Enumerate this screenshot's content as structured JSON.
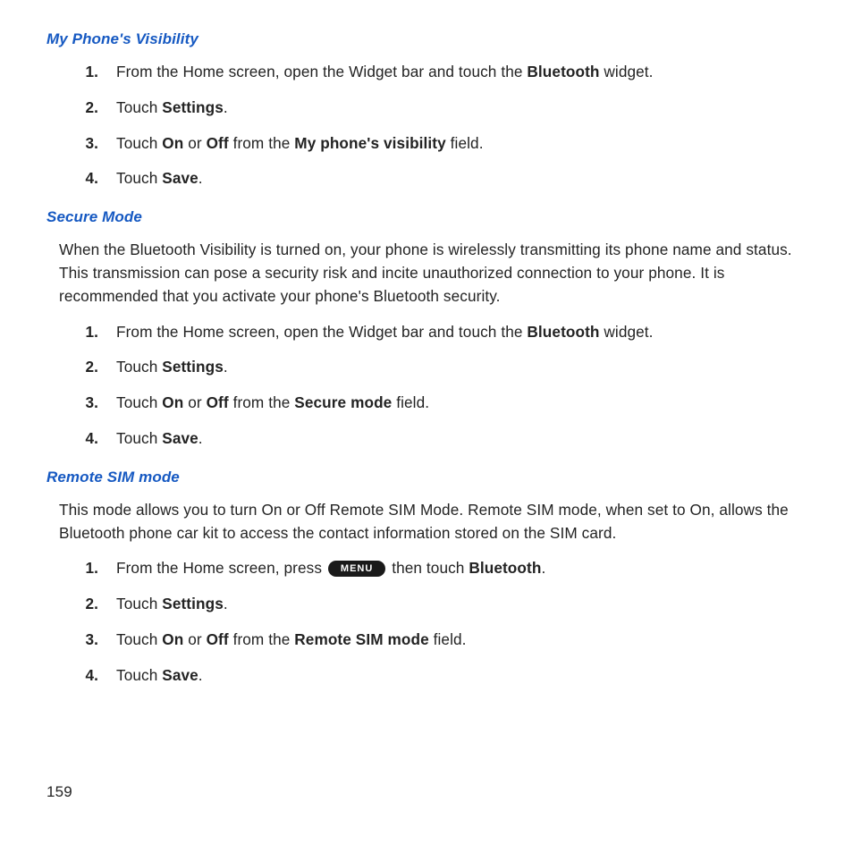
{
  "page_number": "159",
  "menu_icon_label": "MENU",
  "sections": [
    {
      "heading": "My Phone's Visibility",
      "paragraph": null,
      "steps": [
        {
          "num": "1.",
          "pre": "From the Home screen, open the Widget bar and touch the ",
          "bold1": "Bluetooth",
          "mid": " widget.",
          "bold2": null,
          "mid2": null,
          "bold3": null,
          "post": null,
          "has_menu": false
        },
        {
          "num": "2.",
          "pre": "Touch ",
          "bold1": "Settings",
          "mid": ".",
          "bold2": null,
          "mid2": null,
          "bold3": null,
          "post": null,
          "has_menu": false
        },
        {
          "num": "3.",
          "pre": "Touch ",
          "bold1": "On",
          "mid": " or ",
          "bold2": "Off",
          "mid2": " from the ",
          "bold3": "My phone's visibility",
          "post": " field.",
          "has_menu": false
        },
        {
          "num": "4.",
          "pre": "Touch ",
          "bold1": "Save",
          "mid": ".",
          "bold2": null,
          "mid2": null,
          "bold3": null,
          "post": null,
          "has_menu": false
        }
      ]
    },
    {
      "heading": "Secure Mode",
      "paragraph": "When the Bluetooth Visibility is turned on, your phone is wirelessly transmitting its phone name and status. This transmission can pose a security risk and incite unauthorized connection to your phone. It is recommended that you activate your phone's Bluetooth security.",
      "steps": [
        {
          "num": "1.",
          "pre": "From the Home screen, open the Widget bar and touch the ",
          "bold1": "Bluetooth",
          "mid": " widget.",
          "bold2": null,
          "mid2": null,
          "bold3": null,
          "post": null,
          "has_menu": false
        },
        {
          "num": "2.",
          "pre": "Touch ",
          "bold1": "Settings",
          "mid": ".",
          "bold2": null,
          "mid2": null,
          "bold3": null,
          "post": null,
          "has_menu": false
        },
        {
          "num": "3.",
          "pre": "Touch ",
          "bold1": "On",
          "mid": " or ",
          "bold2": "Off",
          "mid2": " from the ",
          "bold3": "Secure mode",
          "post": " field.",
          "has_menu": false
        },
        {
          "num": "4.",
          "pre": "Touch ",
          "bold1": "Save",
          "mid": ".",
          "bold2": null,
          "mid2": null,
          "bold3": null,
          "post": null,
          "has_menu": false
        }
      ]
    },
    {
      "heading": "Remote SIM mode",
      "paragraph": "This mode allows you to turn On or Off Remote SIM Mode. Remote SIM mode, when set to On, allows the Bluetooth phone car kit to access the contact information stored on the SIM card.",
      "steps": [
        {
          "num": "1.",
          "pre": "From the Home screen, press ",
          "bold1": null,
          "mid": " then touch ",
          "bold2": "Bluetooth",
          "mid2": ".",
          "bold3": null,
          "post": null,
          "has_menu": true
        },
        {
          "num": "2.",
          "pre": "Touch ",
          "bold1": "Settings",
          "mid": ".",
          "bold2": null,
          "mid2": null,
          "bold3": null,
          "post": null,
          "has_menu": false
        },
        {
          "num": "3.",
          "pre": "Touch ",
          "bold1": "On",
          "mid": " or ",
          "bold2": "Off",
          "mid2": " from the ",
          "bold3": "Remote SIM mode",
          "post": " field.",
          "has_menu": false
        },
        {
          "num": "4.",
          "pre": "Touch ",
          "bold1": "Save",
          "mid": ".",
          "bold2": null,
          "mid2": null,
          "bold3": null,
          "post": null,
          "has_menu": false
        }
      ]
    }
  ]
}
